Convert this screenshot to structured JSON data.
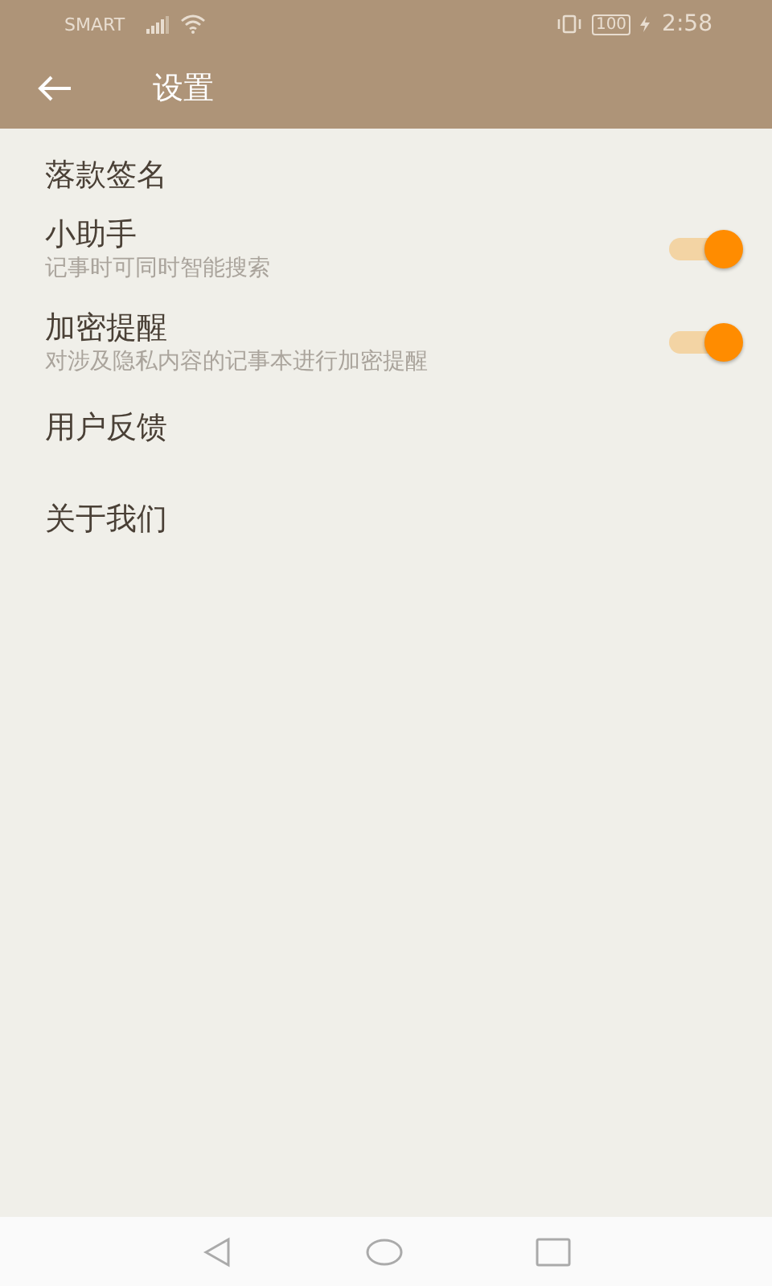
{
  "status_bar": {
    "carrier": "SMART",
    "battery": "100",
    "time": "2:58"
  },
  "app_bar": {
    "title": "设置"
  },
  "items": [
    {
      "kind": "plain",
      "title": "落款签名"
    },
    {
      "kind": "toggle",
      "title": "小助手",
      "subtitle": "记事时可同时智能搜索",
      "on": true
    },
    {
      "kind": "toggle",
      "title": "加密提醒",
      "subtitle": "对涉及隐私内容的记事本进行加密提醒",
      "on": true
    },
    {
      "kind": "plain",
      "title": "用户反馈"
    },
    {
      "kind": "plain",
      "title": "关于我们"
    }
  ]
}
